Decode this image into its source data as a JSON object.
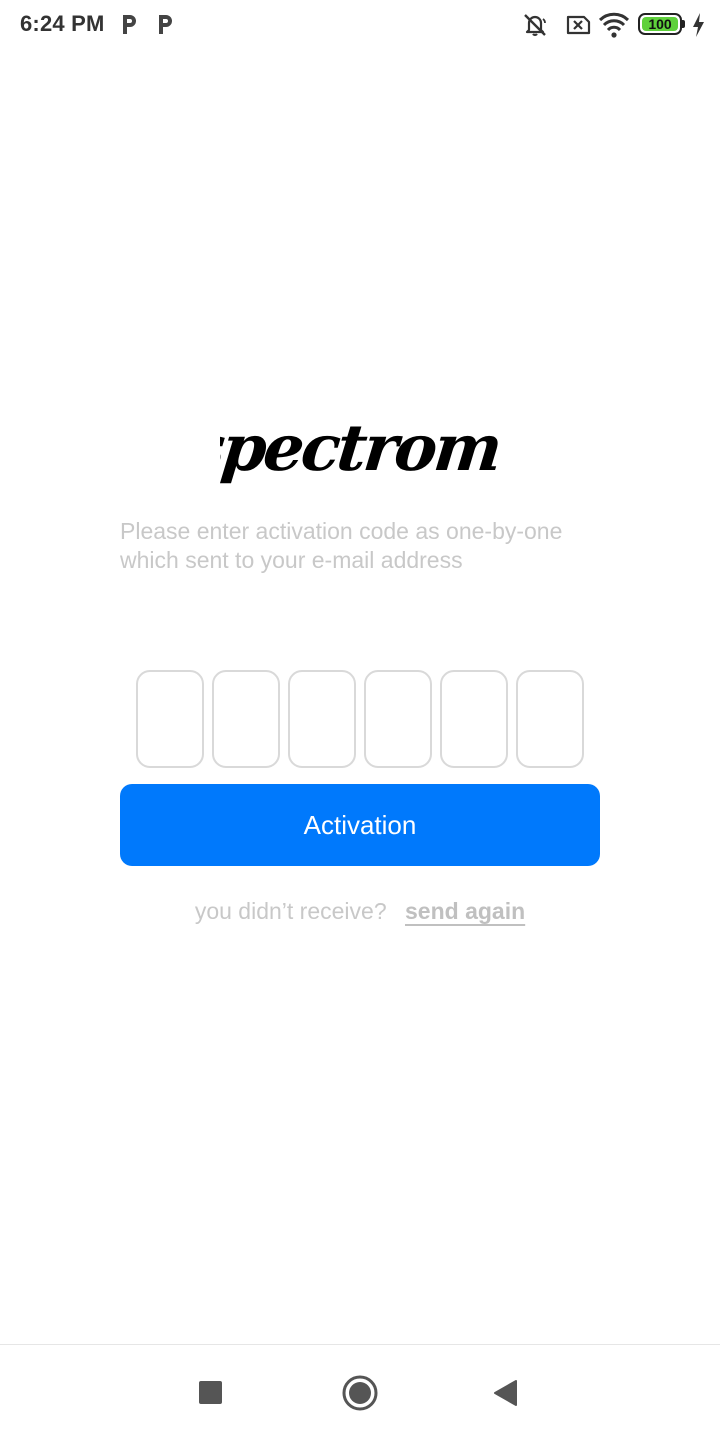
{
  "status_bar": {
    "time": "6:24 PM",
    "notification_icons": [
      "parking-icon",
      "parking-icon"
    ],
    "system_icons": [
      "mute-icon",
      "sim-error-icon",
      "wifi-icon",
      "battery-icon",
      "charging-icon"
    ],
    "battery_level": "100",
    "battery_color": "#5fd13b"
  },
  "logo": {
    "text": "spectrome"
  },
  "instruction": {
    "text": "Please enter activation code as one-by-one which sent to your e-mail address"
  },
  "code_inputs": {
    "count": 6,
    "values": [
      "",
      "",
      "",
      "",
      "",
      ""
    ]
  },
  "activation_button": {
    "label": "Activation",
    "color": "#0079fc"
  },
  "resend": {
    "question": "you didn’t receive?",
    "link": "send again"
  },
  "nav_bar": {
    "buttons": [
      "recent-apps-icon",
      "home-icon",
      "back-icon"
    ]
  }
}
